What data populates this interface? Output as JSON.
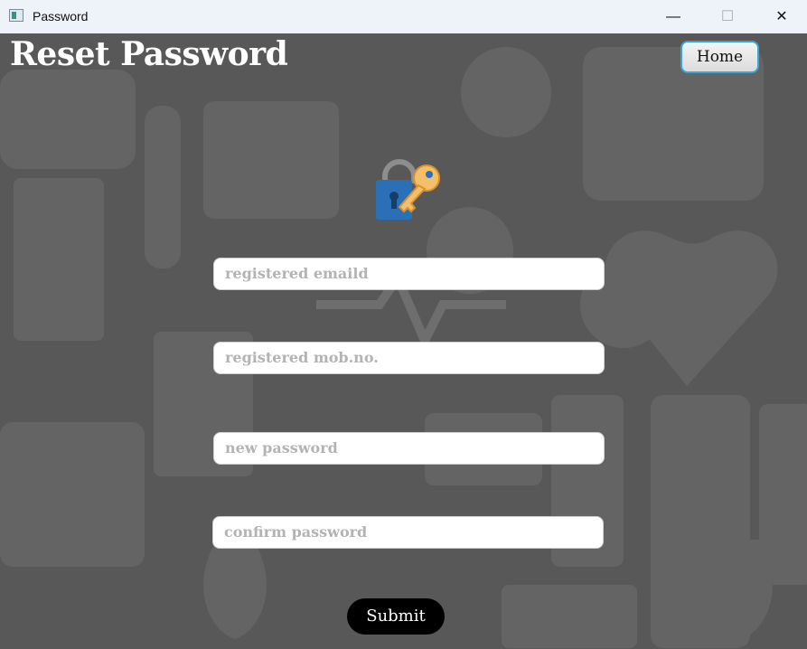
{
  "window": {
    "title": "Password",
    "controls": {
      "minimize": "—",
      "maximize": "☐",
      "close": "✕"
    }
  },
  "page": {
    "title": "Reset Password",
    "home_label": "Home",
    "icon": "lock-key-icon"
  },
  "form": {
    "email_placeholder": "registered emaild",
    "mobile_placeholder": "registered mob.no.",
    "new_password_placeholder": "new password",
    "confirm_password_placeholder": "confirm password",
    "submit_label": "Submit"
  },
  "colors": {
    "background": "#585858",
    "accent": "#3aa5d6",
    "submit": "#000000"
  }
}
